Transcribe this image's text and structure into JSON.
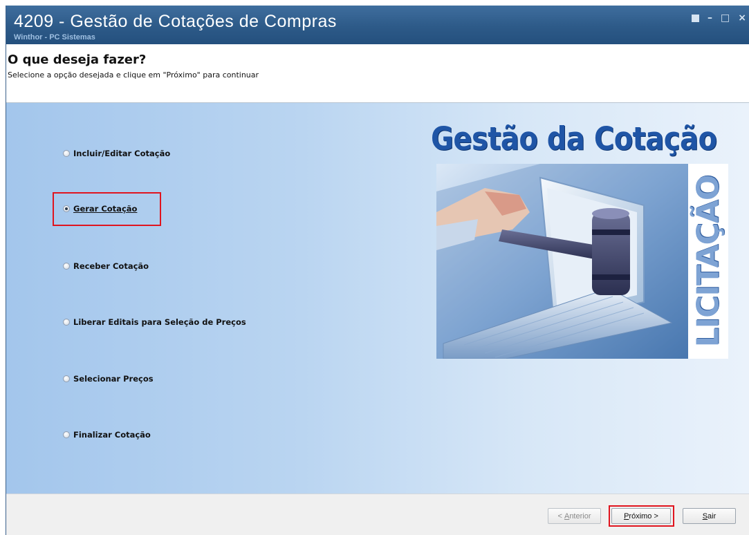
{
  "window": {
    "title": "4209 - Gestão de Cotações de Compras",
    "subtitle": "Winthor - PC Sistemas",
    "controls": [
      "restore-icon",
      "minimize-icon",
      "maximize-icon",
      "close-icon"
    ]
  },
  "header": {
    "title": "O que deseja fazer?",
    "subtitle": "Selecione a opção desejada e clique em \"Próximo\" para continuar"
  },
  "options": [
    {
      "label": "Incluir/Editar Cotação",
      "checked": false
    },
    {
      "label": "Gerar Cotação",
      "checked": true
    },
    {
      "label": "Receber Cotação",
      "checked": false
    },
    {
      "label": "Liberar Editais para Seleção de Preços",
      "checked": false
    },
    {
      "label": "Selecionar Preços",
      "checked": false
    },
    {
      "label": "Finalizar Cotação",
      "checked": false
    }
  ],
  "artwork": {
    "title": "Gestão da Cotação",
    "side_text": "LICITAÇÃO"
  },
  "footer": {
    "anterior_prefix": "< ",
    "anterior_accel": "A",
    "anterior_rest": "nterior",
    "proximo_accel": "P",
    "proximo_rest": "róximo >",
    "sair_accel": "S",
    "sair_rest": "air"
  },
  "colors": {
    "titlebar": "#2d5a88",
    "highlight": "#e0141e",
    "art_title": "#1f55a6"
  }
}
